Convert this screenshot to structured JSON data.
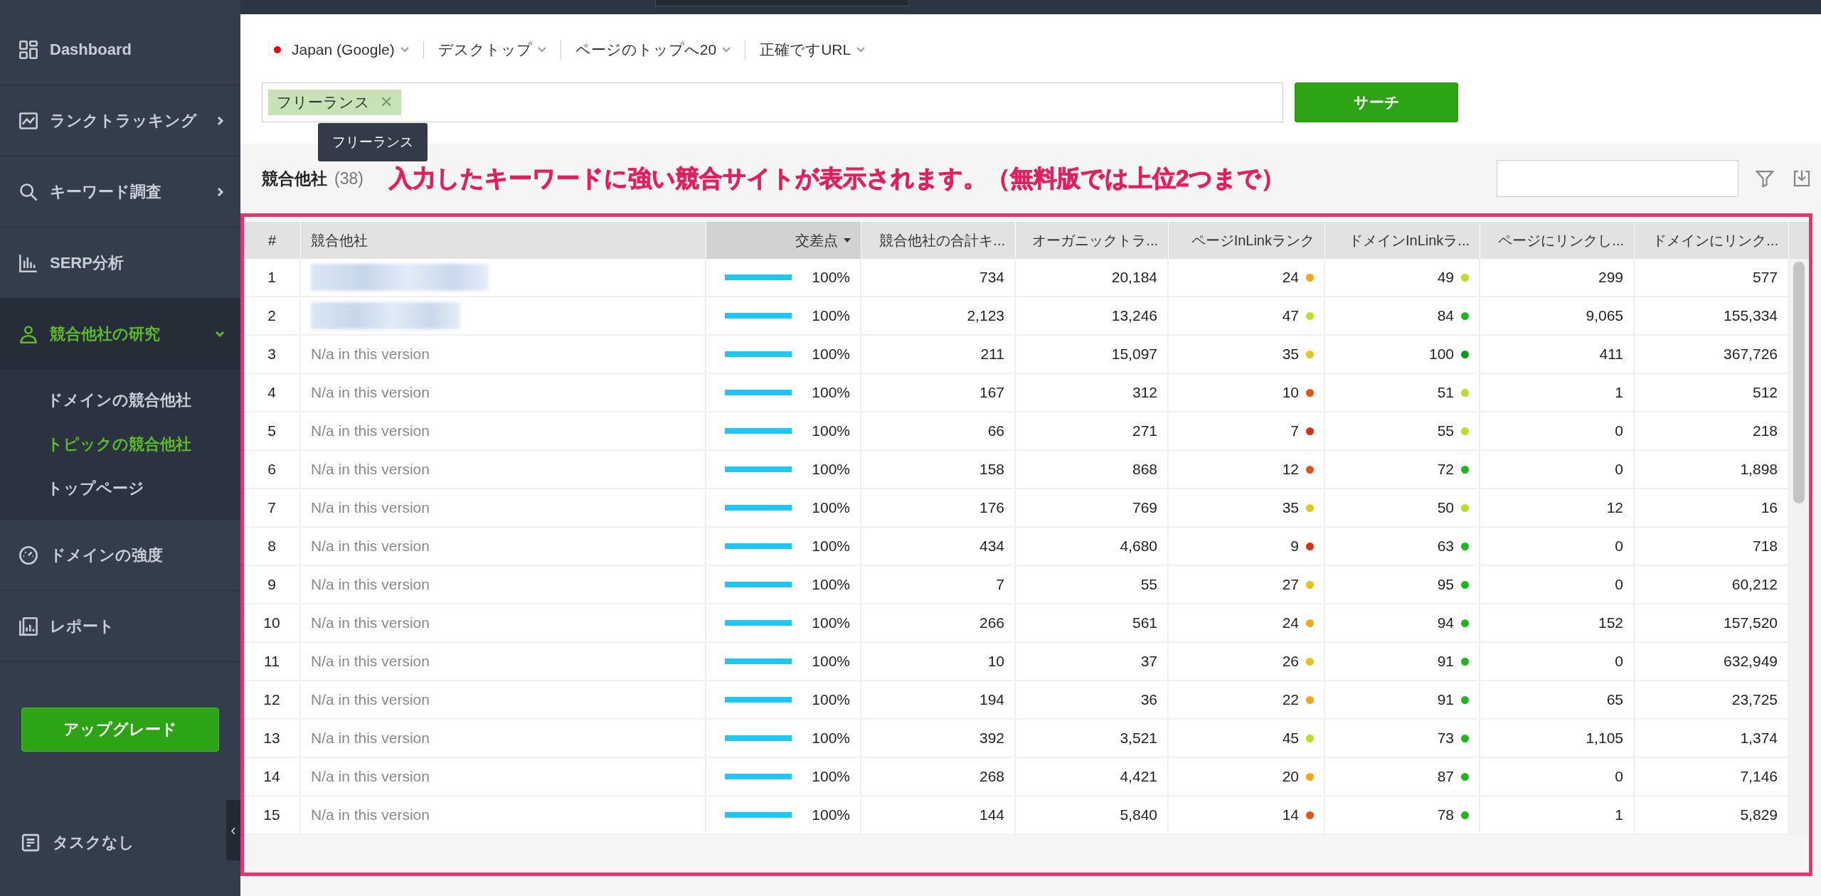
{
  "sidebar": {
    "items": [
      {
        "label": "Dashboard",
        "selected": false
      },
      {
        "label": "ランクトラッキング",
        "selected": false,
        "expanded": false
      },
      {
        "label": "キーワード調査",
        "selected": false,
        "expanded": false
      },
      {
        "label": "SERP分析",
        "selected": false
      },
      {
        "label": "競合他社の研究",
        "selected": true,
        "expanded": true,
        "children": [
          {
            "label": "ドメインの競合他社",
            "selected": false
          },
          {
            "label": "トピックの競合他社",
            "selected": true
          },
          {
            "label": "トップページ",
            "selected": false
          }
        ]
      },
      {
        "label": "ドメインの強度",
        "selected": false
      },
      {
        "label": "レポート",
        "selected": false
      }
    ],
    "upgrade_button": "アップグレード",
    "tasks": "タスクなし",
    "collapse": "‹"
  },
  "filters": [
    {
      "label": "Japan (Google)",
      "kind": "flag"
    },
    {
      "label": "デスクトップ",
      "kind": "plain"
    },
    {
      "label": "ページのトップへ20",
      "kind": "plain"
    },
    {
      "label": "正確ですURL",
      "kind": "plain"
    }
  ],
  "keyword_input": {
    "tags": [
      {
        "label": "フリーランス",
        "remove": "✕"
      }
    ],
    "tooltip": "フリーランス"
  },
  "search_button": "サーチ",
  "competitors": {
    "title": "競合他社",
    "count": "(38)"
  },
  "annotation": {
    "text": "入力したキーワードに強い競合サイトが表示されます。（無料版では上位2つまで）"
  },
  "table": {
    "columns": [
      {
        "label": "#",
        "sorted": false
      },
      {
        "label": "競合他社",
        "sorted": false
      },
      {
        "label": "交差点",
        "sorted": true
      },
      {
        "label": "競合他社の合計キ...",
        "sorted": false
      },
      {
        "label": "オーガニックトラ...",
        "sorted": false
      },
      {
        "label": "ページInLinkランク",
        "sorted": false
      },
      {
        "label": "ドメインInLinkラ...",
        "sorted": false
      },
      {
        "label": "ページにリンクし...",
        "sorted": false
      },
      {
        "label": "ドメインにリンク...",
        "sorted": false
      }
    ],
    "rows": [
      {
        "rank": "1",
        "competitor": {
          "kind": "blurred"
        },
        "intersection": {
          "level": 1,
          "text": "100%"
        },
        "total_keywords": "734",
        "organic": "20,184",
        "page_inlink": {
          "value": "24",
          "color": "#f0a818"
        },
        "domain_inlink": {
          "value": "49",
          "color": "#b6e02a"
        },
        "page_links": "299",
        "domain_links": "577"
      },
      {
        "rank": "2",
        "competitor": {
          "kind": "blurred"
        },
        "intersection": {
          "level": 1,
          "text": "100%"
        },
        "total_keywords": "2,123",
        "organic": "13,246",
        "page_inlink": {
          "value": "47",
          "color": "#b6e02a"
        },
        "domain_inlink": {
          "value": "84",
          "color": "#22b41c"
        },
        "page_links": "9,065",
        "domain_links": "155,334"
      },
      {
        "rank": "3",
        "competitor": {
          "kind": "text",
          "text": "N/a in this version"
        },
        "intersection": {
          "level": 1,
          "text": "100%"
        },
        "total_keywords": "211",
        "organic": "15,097",
        "page_inlink": {
          "value": "35",
          "color": "#e2c81c"
        },
        "domain_inlink": {
          "value": "100",
          "color": "#0c9a1c"
        },
        "page_links": "411",
        "domain_links": "367,726"
      },
      {
        "rank": "4",
        "competitor": {
          "kind": "text",
          "text": "N/a in this version"
        },
        "intersection": {
          "level": 1,
          "text": "100%"
        },
        "total_keywords": "167",
        "organic": "312",
        "page_inlink": {
          "value": "10",
          "color": "#e0541a"
        },
        "domain_inlink": {
          "value": "51",
          "color": "#b6e02a"
        },
        "page_links": "1",
        "domain_links": "512"
      },
      {
        "rank": "5",
        "competitor": {
          "kind": "text",
          "text": "N/a in this version"
        },
        "intersection": {
          "level": 1,
          "text": "100%"
        },
        "total_keywords": "66",
        "organic": "271",
        "page_inlink": {
          "value": "7",
          "color": "#d23418"
        },
        "domain_inlink": {
          "value": "55",
          "color": "#b6e02a"
        },
        "page_links": "0",
        "domain_links": "218"
      },
      {
        "rank": "6",
        "competitor": {
          "kind": "text",
          "text": "N/a in this version"
        },
        "intersection": {
          "level": 1,
          "text": "100%"
        },
        "total_keywords": "158",
        "organic": "868",
        "page_inlink": {
          "value": "12",
          "color": "#e0541a"
        },
        "domain_inlink": {
          "value": "72",
          "color": "#22b41c"
        },
        "page_links": "0",
        "domain_links": "1,898"
      },
      {
        "rank": "7",
        "competitor": {
          "kind": "text",
          "text": "N/a in this version"
        },
        "intersection": {
          "level": 1,
          "text": "100%"
        },
        "total_keywords": "176",
        "organic": "769",
        "page_inlink": {
          "value": "35",
          "color": "#e2c81c"
        },
        "domain_inlink": {
          "value": "50",
          "color": "#b6e02a"
        },
        "page_links": "12",
        "domain_links": "16"
      },
      {
        "rank": "8",
        "competitor": {
          "kind": "text",
          "text": "N/a in this version"
        },
        "intersection": {
          "level": 1,
          "text": "100%"
        },
        "total_keywords": "434",
        "organic": "4,680",
        "page_inlink": {
          "value": "9",
          "color": "#d23418"
        },
        "domain_inlink": {
          "value": "63",
          "color": "#22b41c"
        },
        "page_links": "0",
        "domain_links": "718"
      },
      {
        "rank": "9",
        "competitor": {
          "kind": "text",
          "text": "N/a in this version"
        },
        "intersection": {
          "level": 1,
          "text": "100%"
        },
        "total_keywords": "7",
        "organic": "55",
        "page_inlink": {
          "value": "27",
          "color": "#e8c01c"
        },
        "domain_inlink": {
          "value": "95",
          "color": "#22b41c"
        },
        "page_links": "0",
        "domain_links": "60,212"
      },
      {
        "rank": "10",
        "competitor": {
          "kind": "text",
          "text": "N/a in this version"
        },
        "intersection": {
          "level": 1,
          "text": "100%"
        },
        "total_keywords": "266",
        "organic": "561",
        "page_inlink": {
          "value": "24",
          "color": "#f0a818"
        },
        "domain_inlink": {
          "value": "94",
          "color": "#22b41c"
        },
        "page_links": "152",
        "domain_links": "157,520"
      },
      {
        "rank": "11",
        "competitor": {
          "kind": "text",
          "text": "N/a in this version"
        },
        "intersection": {
          "level": 1,
          "text": "100%"
        },
        "total_keywords": "10",
        "organic": "37",
        "page_inlink": {
          "value": "26",
          "color": "#e8c01c"
        },
        "domain_inlink": {
          "value": "91",
          "color": "#22b41c"
        },
        "page_links": "0",
        "domain_links": "632,949"
      },
      {
        "rank": "12",
        "competitor": {
          "kind": "text",
          "text": "N/a in this version"
        },
        "intersection": {
          "level": 1,
          "text": "100%"
        },
        "total_keywords": "194",
        "organic": "36",
        "page_inlink": {
          "value": "22",
          "color": "#f0a818"
        },
        "domain_inlink": {
          "value": "91",
          "color": "#22b41c"
        },
        "page_links": "65",
        "domain_links": "23,725"
      },
      {
        "rank": "13",
        "competitor": {
          "kind": "text",
          "text": "N/a in this version"
        },
        "intersection": {
          "level": 1,
          "text": "100%"
        },
        "total_keywords": "392",
        "organic": "3,521",
        "page_inlink": {
          "value": "45",
          "color": "#b6e02a"
        },
        "domain_inlink": {
          "value": "73",
          "color": "#22b41c"
        },
        "page_links": "1,105",
        "domain_links": "1,374"
      },
      {
        "rank": "14",
        "competitor": {
          "kind": "text",
          "text": "N/a in this version"
        },
        "intersection": {
          "level": 1,
          "text": "100%"
        },
        "total_keywords": "268",
        "organic": "4,421",
        "page_inlink": {
          "value": "20",
          "color": "#f0a818"
        },
        "domain_inlink": {
          "value": "87",
          "color": "#22b41c"
        },
        "page_links": "0",
        "domain_links": "7,146"
      },
      {
        "rank": "15",
        "competitor": {
          "kind": "text",
          "text": "N/a in this version"
        },
        "intersection": {
          "level": 1,
          "text": "100%"
        },
        "total_keywords": "144",
        "organic": "5,840",
        "page_inlink": {
          "value": "14",
          "color": "#e0541a"
        },
        "domain_inlink": {
          "value": "78",
          "color": "#22b41c"
        },
        "page_links": "1",
        "domain_links": "5,829"
      }
    ]
  }
}
